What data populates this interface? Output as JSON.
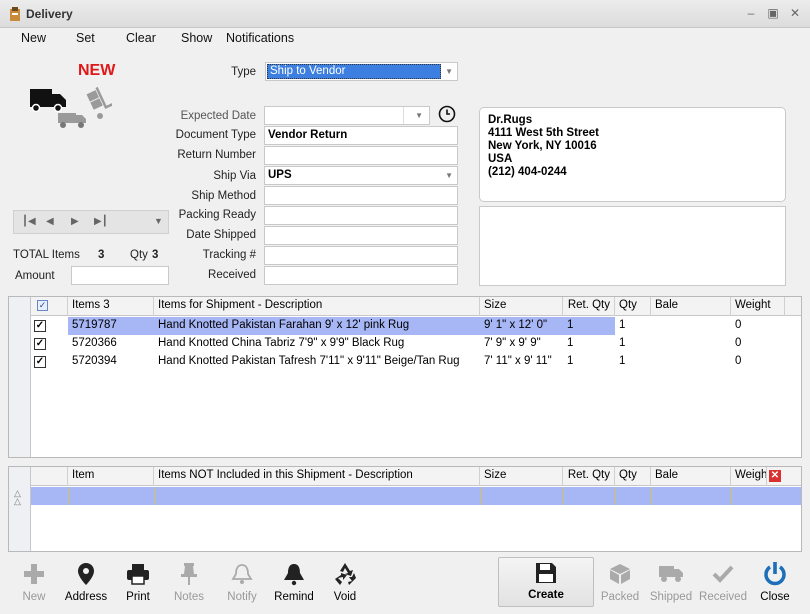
{
  "window": {
    "title": "Delivery"
  },
  "menu": [
    "New",
    "Set",
    "Clear",
    "Show",
    "Notifications"
  ],
  "status": {
    "new_label": "NEW"
  },
  "type": {
    "label": "Type",
    "value": "Ship to Vendor"
  },
  "form": {
    "expected_date": {
      "label": "Expected Date",
      "value": ""
    },
    "document_type": {
      "label": "Document Type",
      "value": "Vendor Return"
    },
    "return_number": {
      "label": "Return Number",
      "value": ""
    },
    "ship_via": {
      "label": "Ship Via",
      "value": "UPS"
    },
    "ship_method": {
      "label": "Ship Method",
      "value": ""
    },
    "packing_ready": {
      "label": "Packing Ready",
      "value": ""
    },
    "date_shipped": {
      "label": "Date Shipped",
      "value": ""
    },
    "tracking": {
      "label": "Tracking #",
      "value": ""
    },
    "received": {
      "label": "Received",
      "value": ""
    }
  },
  "address": {
    "lines": [
      "Dr.Rugs",
      "4111 West 5th Street",
      "New York, NY 10016",
      "USA",
      "(212) 404-0244"
    ]
  },
  "totals": {
    "items_label": "TOTAL Items",
    "items_value": "3",
    "qty_label": "Qty",
    "qty_value": "3",
    "amount_label": "Amount",
    "amount_value": ""
  },
  "shipment_grid": {
    "columns": [
      "Items 3",
      "Items for Shipment - Description",
      "Size",
      "Ret. Qty",
      "Qty",
      "Bale",
      "Weight"
    ],
    "rows": [
      {
        "item": "5719787",
        "desc": "Hand Knotted Pakistan Farahan 9' x 12' pink Rug",
        "size": "9' 1\" x 12' 0\"",
        "ret_qty": "1",
        "qty": "1",
        "bale": "",
        "weight": "0"
      },
      {
        "item": "5720366",
        "desc": "Hand Knotted China Tabriz 7'9\" x 9'9\" Black Rug",
        "size": "7' 9\" x 9' 9\"",
        "ret_qty": "1",
        "qty": "1",
        "bale": "",
        "weight": "0"
      },
      {
        "item": "5720394",
        "desc": "Hand Knotted Pakistan Tafresh 7'11\" x 9'11\" Beige/Tan Rug",
        "size": "7' 11\" x 9' 11\"",
        "ret_qty": "1",
        "qty": "1",
        "bale": "",
        "weight": "0"
      }
    ]
  },
  "excluded_grid": {
    "columns": [
      "Item",
      "Items NOT Included in this Shipment - Description",
      "Size",
      "Ret. Qty",
      "Qty",
      "Bale",
      "Weigh"
    ]
  },
  "toolbar": {
    "new": "New",
    "address": "Address",
    "print": "Print",
    "notes": "Notes",
    "notify": "Notify",
    "remind": "Remind",
    "void": "Void",
    "create": "Create",
    "packed": "Packed",
    "shipped": "Shipped",
    "received": "Received",
    "close": "Close"
  },
  "colors": {
    "accent": "#3c7fe0",
    "new_red": "#e01818",
    "row_highlight": "#a7b6f5",
    "close_blue": "#1c6fb8"
  }
}
